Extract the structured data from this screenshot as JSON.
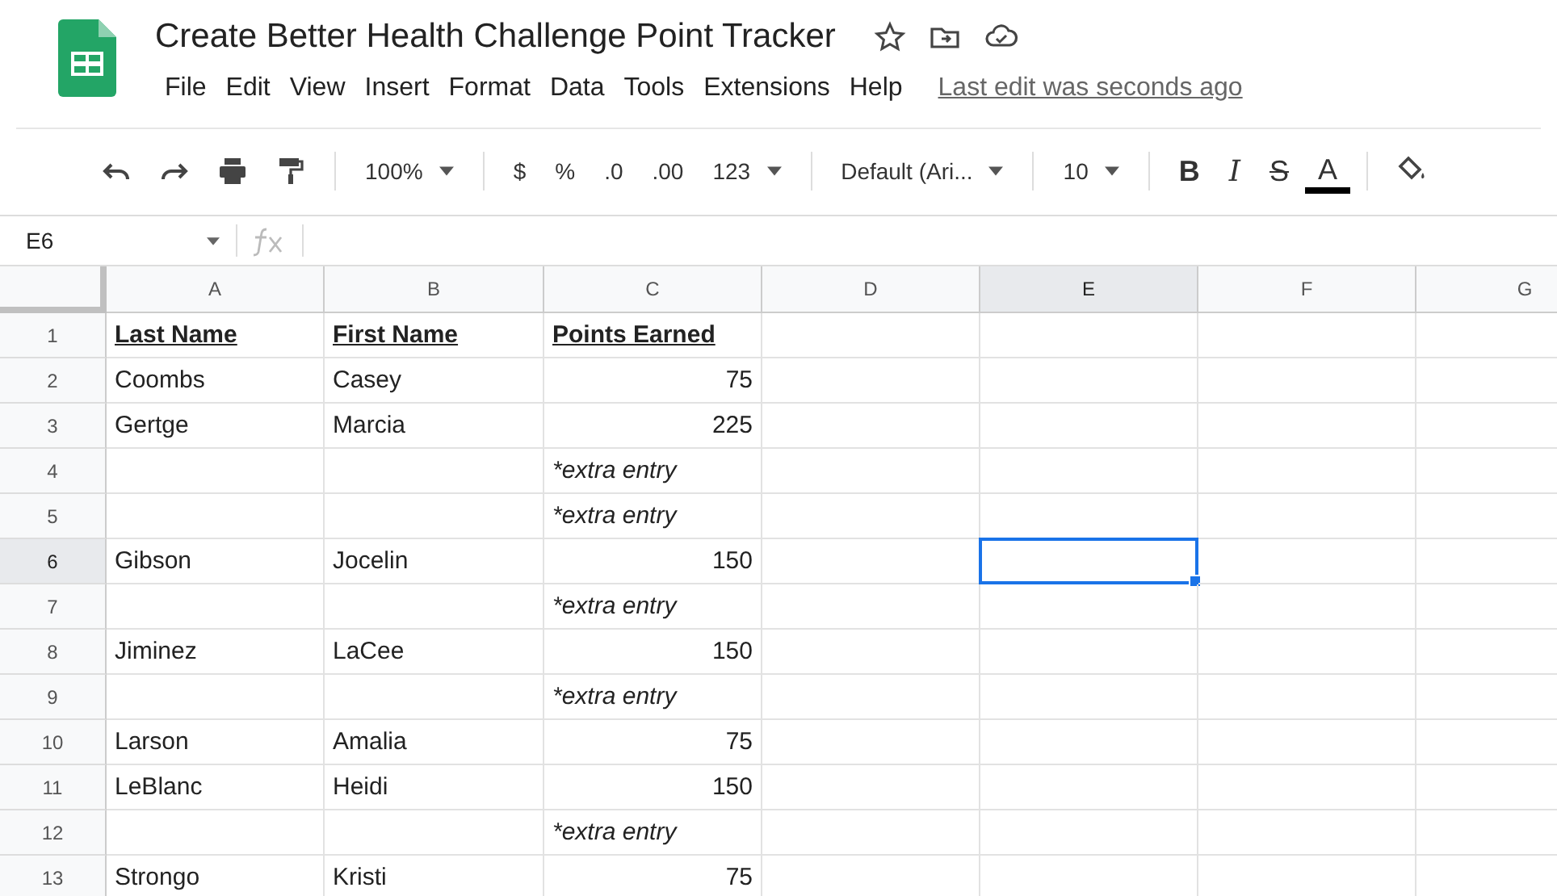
{
  "document": {
    "title": "Create Better Health Challenge Point Tracker",
    "last_edit": "Last edit was seconds ago"
  },
  "menu": [
    "File",
    "Edit",
    "View",
    "Insert",
    "Format",
    "Data",
    "Tools",
    "Extensions",
    "Help"
  ],
  "toolbar": [
    {
      "kind": "undo"
    },
    {
      "kind": "redo"
    },
    {
      "kind": "print"
    },
    {
      "kind": "paint"
    },
    {
      "kind": "sep"
    },
    {
      "kind": "dropdown",
      "text": "100%"
    },
    {
      "kind": "sep"
    },
    {
      "kind": "text",
      "text": "$"
    },
    {
      "kind": "text",
      "text": "%"
    },
    {
      "kind": "text",
      "text": ".0"
    },
    {
      "kind": "text",
      "text": ".00"
    },
    {
      "kind": "dropdown",
      "text": "123"
    },
    {
      "kind": "sep"
    },
    {
      "kind": "dropdown",
      "text": "Default (Ari..."
    },
    {
      "kind": "sep"
    },
    {
      "kind": "dropdown",
      "text": "10"
    },
    {
      "kind": "sep"
    },
    {
      "kind": "bold",
      "text": "B"
    },
    {
      "kind": "italic",
      "text": "I"
    },
    {
      "kind": "strike",
      "text": "S"
    },
    {
      "kind": "textcolor",
      "text": "A"
    },
    {
      "kind": "sep"
    },
    {
      "kind": "fill"
    }
  ],
  "name_box": "E6",
  "columns": [
    {
      "label": "A",
      "selected": false
    },
    {
      "label": "B",
      "selected": false
    },
    {
      "label": "C",
      "selected": false
    },
    {
      "label": "D",
      "selected": false
    },
    {
      "label": "E",
      "selected": true
    },
    {
      "label": "F",
      "selected": false
    },
    {
      "label": "G",
      "selected": false
    }
  ],
  "rows": [
    {
      "number": "1",
      "kind": "header",
      "selected": false,
      "last_name": "Last Name",
      "first_name": "First Name",
      "points": "Points Earned"
    },
    {
      "number": "2",
      "kind": "data",
      "selected": false,
      "last_name": "Coombs",
      "first_name": "Casey",
      "points": "75"
    },
    {
      "number": "3",
      "kind": "data",
      "selected": false,
      "last_name": "Gertge",
      "first_name": "Marcia",
      "points": "225"
    },
    {
      "number": "4",
      "kind": "note",
      "selected": false,
      "points": "*extra entry"
    },
    {
      "number": "5",
      "kind": "note",
      "selected": false,
      "points": "*extra entry"
    },
    {
      "number": "6",
      "kind": "data",
      "selected": true,
      "last_name": "Gibson",
      "first_name": "Jocelin",
      "points": "150"
    },
    {
      "number": "7",
      "kind": "note",
      "selected": false,
      "points": "*extra entry"
    },
    {
      "number": "8",
      "kind": "data",
      "selected": false,
      "last_name": "Jiminez",
      "first_name": "LaCee",
      "points": "150"
    },
    {
      "number": "9",
      "kind": "note",
      "selected": false,
      "points": "*extra entry"
    },
    {
      "number": "10",
      "kind": "data",
      "selected": false,
      "last_name": "Larson",
      "first_name": "Amalia",
      "points": "75"
    },
    {
      "number": "11",
      "kind": "data",
      "selected": false,
      "last_name": "LeBlanc",
      "first_name": "Heidi",
      "points": "150"
    },
    {
      "number": "12",
      "kind": "note",
      "selected": false,
      "points": "*extra entry"
    },
    {
      "number": "13",
      "kind": "data",
      "selected": false,
      "last_name": "Strongo",
      "first_name": "Kristi",
      "points": "75"
    }
  ]
}
